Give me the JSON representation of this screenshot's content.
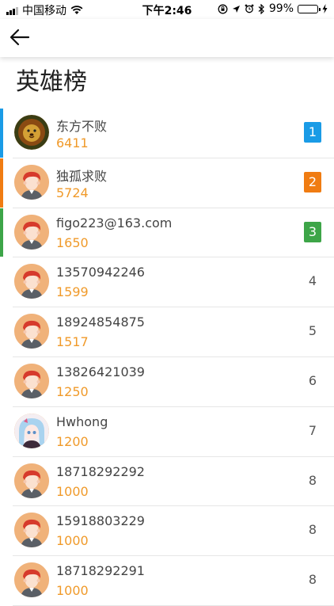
{
  "status_bar": {
    "carrier": "中国移动",
    "time": "下午2:46",
    "battery": "99%",
    "battery_level": 0.99
  },
  "page": {
    "title": "英雄榜"
  },
  "colors": {
    "accent_1": "#1a9be6",
    "accent_2": "#f07c12",
    "accent_3": "#3da548",
    "score": "#f09a2a"
  },
  "leaderboard": [
    {
      "name": "东方不败",
      "score": "6411",
      "rank": "1",
      "avatar": "lion-avatar"
    },
    {
      "name": "独孤求败",
      "score": "5724",
      "rank": "2",
      "avatar": "default-avatar"
    },
    {
      "name": "figo223@163.com",
      "score": "1650",
      "rank": "3",
      "avatar": "default-avatar"
    },
    {
      "name": "13570942246",
      "score": "1599",
      "rank": "4",
      "avatar": "default-avatar"
    },
    {
      "name": "18924854875",
      "score": "1517",
      "rank": "5",
      "avatar": "default-avatar"
    },
    {
      "name": "13826421039",
      "score": "1250",
      "rank": "6",
      "avatar": "default-avatar"
    },
    {
      "name": "Hwhong",
      "score": "1200",
      "rank": "7",
      "avatar": "anime-avatar"
    },
    {
      "name": "18718292292",
      "score": "1000",
      "rank": "8",
      "avatar": "default-avatar"
    },
    {
      "name": "15918803229",
      "score": "1000",
      "rank": "8",
      "avatar": "default-avatar"
    },
    {
      "name": "18718292291",
      "score": "1000",
      "rank": "8",
      "avatar": "default-avatar"
    }
  ]
}
